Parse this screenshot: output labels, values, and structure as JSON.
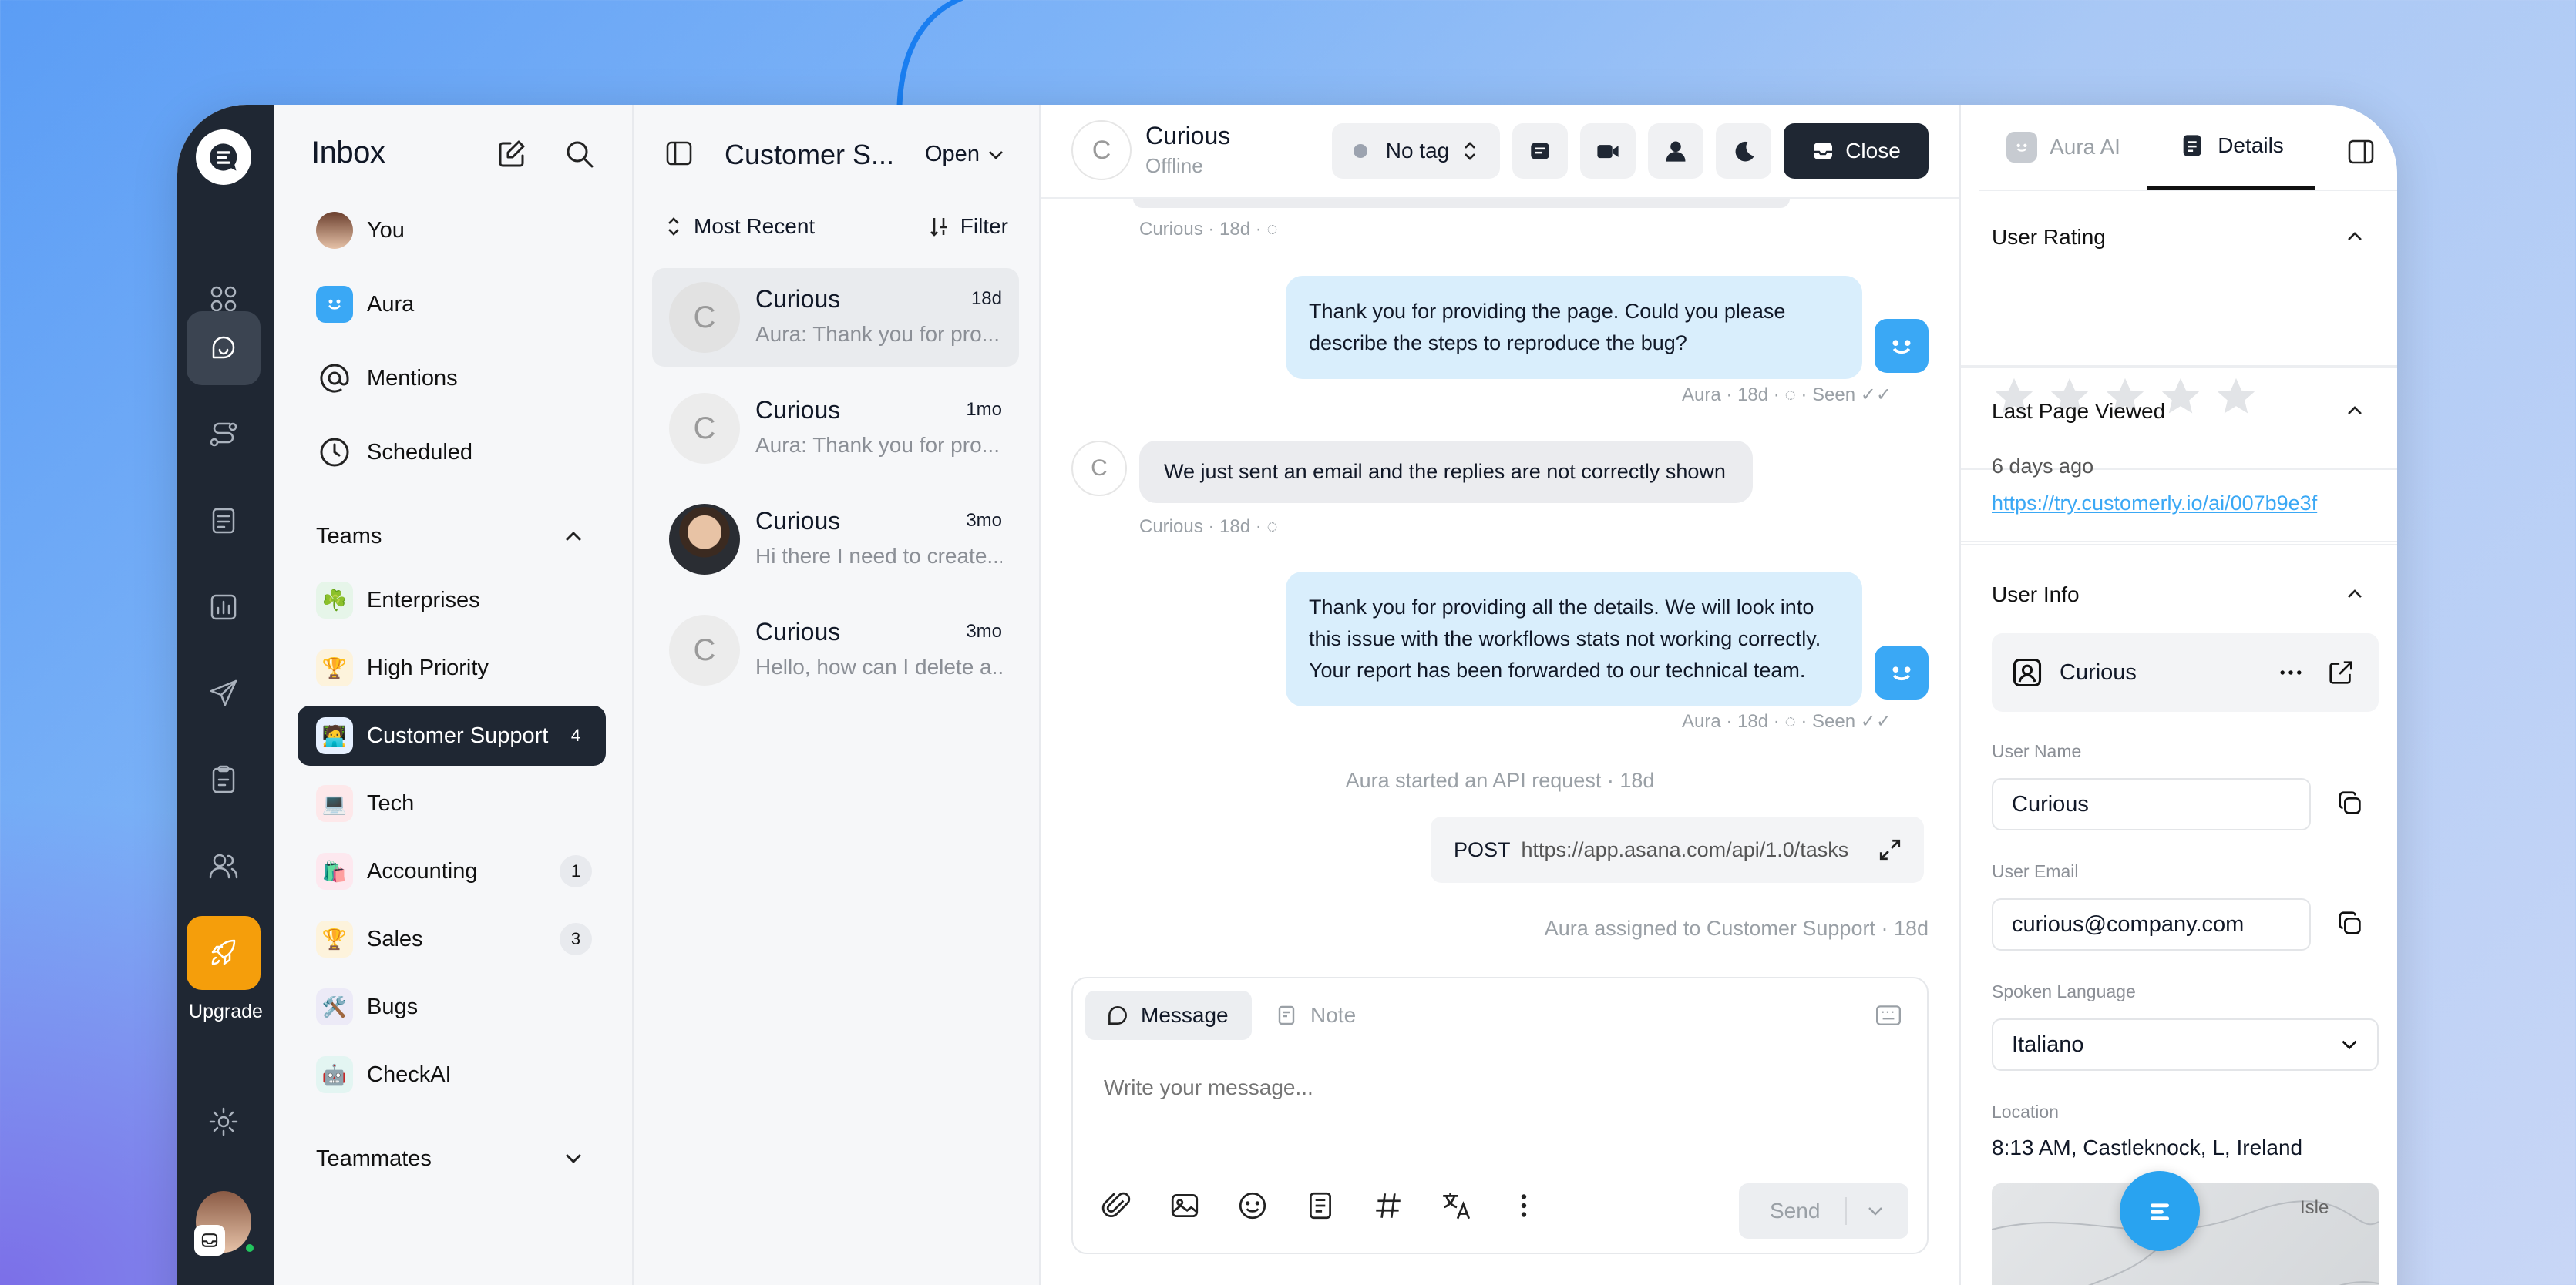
{
  "sidebar": {
    "title": "Inbox",
    "upgrade_label": "Upgrade",
    "items": [
      {
        "label": "You"
      },
      {
        "label": "Aura"
      },
      {
        "label": "Mentions"
      },
      {
        "label": "Scheduled"
      }
    ],
    "teams_label": "Teams",
    "teams": [
      {
        "label": "Enterprises",
        "emoji": "☘️",
        "count": ""
      },
      {
        "label": "High Priority",
        "emoji": "🏆",
        "count": ""
      },
      {
        "label": "Customer Support",
        "emoji": "🧑‍💻",
        "count": "4"
      },
      {
        "label": "Tech",
        "emoji": "💻",
        "count": ""
      },
      {
        "label": "Accounting",
        "emoji": "🛍️",
        "count": "1"
      },
      {
        "label": "Sales",
        "emoji": "🏆",
        "count": "3"
      },
      {
        "label": "Bugs",
        "emoji": "🛠️",
        "count": ""
      },
      {
        "label": "CheckAI",
        "emoji": "🤖",
        "count": ""
      }
    ],
    "teammates_label": "Teammates"
  },
  "list": {
    "title": "Customer S...",
    "status": "Open",
    "sort": "Most Recent",
    "filter": "Filter",
    "conversations": [
      {
        "avatar": "C",
        "name": "Curious",
        "time": "18d",
        "preview": "Aura: Thank you for pro..."
      },
      {
        "avatar": "C",
        "name": "Curious",
        "time": "1mo",
        "preview": "Aura: Thank you for pro..."
      },
      {
        "avatar": "",
        "name": "Curious",
        "time": "3mo",
        "preview": "Hi there I need to create..."
      },
      {
        "avatar": "C",
        "name": "Curious",
        "time": "3mo",
        "preview": "Hello, how can I delete a..."
      }
    ]
  },
  "chat": {
    "contact_avatar": "C",
    "contact_name": "Curious",
    "contact_status": "Offline",
    "tag": "No tag",
    "close_label": "Close",
    "meta_top": "Curious · 18d ·",
    "msg1": "Thank you for providing the page. Could you please describe the steps to reproduce the bug?",
    "meta1": "Aura · 18d ·",
    "seen1": "· Seen",
    "msg2": "We just sent an email and the replies are not correctly shown",
    "meta2": "Curious · 18d ·",
    "msg3": "Thank you for providing all the details. We will look into this issue with the workflows stats not working correctly. Your report has been forwarded to our technical team.",
    "meta3": "Aura · 18d ·",
    "seen3": "· Seen",
    "api_started": "Aura started an API request · 18d",
    "api_method": "POST",
    "api_url": "https://app.asana.com/api/1.0/tasks",
    "assigned": "Aura assigned to Customer Support · 18d",
    "tab_message": "Message",
    "tab_note": "Note",
    "placeholder": "Write your message...",
    "send_label": "Send"
  },
  "details": {
    "tab_ai": "Aura AI",
    "tab_details": "Details",
    "rating_title": "User Rating",
    "rating": 0,
    "last_page_title": "Last Page Viewed",
    "last_page_time": "6 days ago",
    "last_page_url": "https://try.customerly.io/ai/007b9e3f",
    "user_info_title": "User Info",
    "user_card_name": "Curious",
    "username_label": "User Name",
    "username": "Curious",
    "email_label": "User Email",
    "email": "curious@company.com",
    "language_label": "Spoken Language",
    "language": "Italiano",
    "location_label": "Location",
    "location": "8:13 AM, Castleknock, L, Ireland",
    "map_label": "Isle"
  }
}
